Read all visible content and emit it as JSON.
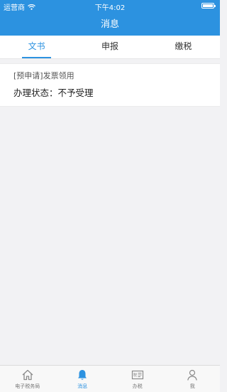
{
  "status_bar": {
    "carrier": "运营商",
    "time": "下午4:02",
    "battery_level": 1.0
  },
  "header": {
    "title": "消息"
  },
  "tabs": [
    {
      "label": "文书",
      "active": true
    },
    {
      "label": "申报",
      "active": false
    },
    {
      "label": "缴税",
      "active": false
    }
  ],
  "messages": [
    {
      "title": "[预申请]发票领用",
      "status": "办理状态：不予受理"
    }
  ],
  "bottom_nav": [
    {
      "label": "电子税务局",
      "icon": "home-icon",
      "active": false
    },
    {
      "label": "消息",
      "icon": "bell-icon",
      "active": true
    },
    {
      "label": "办税",
      "icon": "tax-card-icon",
      "active": false
    },
    {
      "label": "我",
      "icon": "person-icon",
      "active": false
    }
  ],
  "colors": {
    "primary": "#2c92e0",
    "background": "#f2f2f4"
  }
}
